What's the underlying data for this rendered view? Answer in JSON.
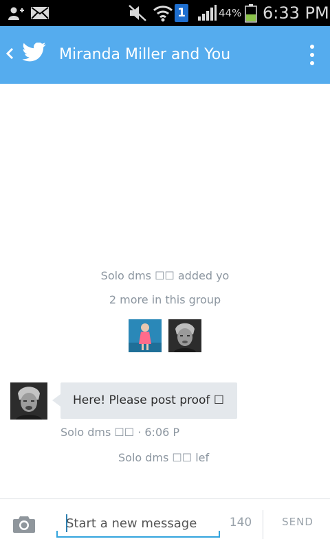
{
  "status_bar": {
    "battery_percent": "44%",
    "time": "6:33 PM",
    "notification_badge": "1",
    "icons": [
      "add-contact-icon",
      "mail-icon",
      "mute-icon",
      "wifi-icon",
      "sim-badge-icon",
      "signal-icon",
      "battery-icon"
    ],
    "battery_level": 0.44,
    "battery_color": "#8bc34a"
  },
  "app_bar": {
    "title": "Miranda Miller and You",
    "color": "#55acee",
    "icons": [
      "back-chevron-icon",
      "twitter-bird-icon",
      "overflow-menu-icon"
    ]
  },
  "conversation": {
    "group_added_text": "Solo dms ☐☐ added yo",
    "more_in_group": "2 more in this group",
    "member_thumbnails": [
      "member-avatar-1",
      "member-avatar-2"
    ],
    "messages": [
      {
        "text": "Here! Please post proof ☐",
        "sender": "Solo dms ☐☐",
        "time": "6:06 P",
        "meta": "Solo dms ☐☐ · 6:06 P"
      }
    ],
    "left_notice": "Solo dms ☐☐ lef"
  },
  "composer": {
    "placeholder": "Start a new message",
    "char_count": "140",
    "send_label": "SEND",
    "accent": "#33a4dd"
  }
}
